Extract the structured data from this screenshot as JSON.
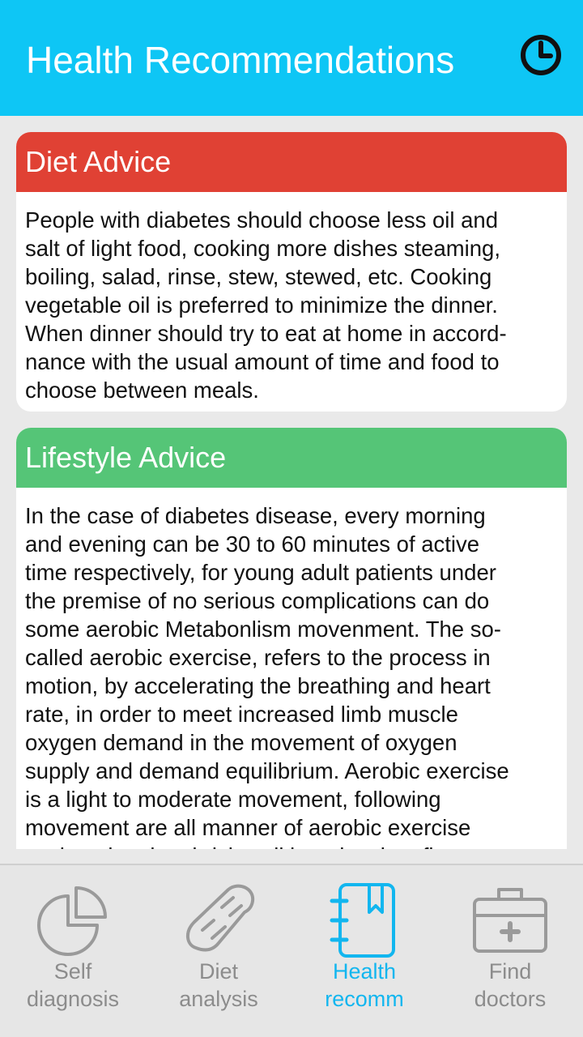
{
  "header": {
    "title": "Health Recommendations",
    "history_icon": "clock-icon"
  },
  "cards": [
    {
      "title": "Diet Advice",
      "color": "#e04134",
      "body": "People with diabetes should choose less oil and\nsalt of light food, cooking more dishes steaming,\nboiling, salad, rinse, stew, stewed, etc. Cooking\nvegetable oil is preferred to minimize the dinner.\nWhen dinner should try to eat at home in accord-\nnance with the usual amount of time and food to\nchoose between meals."
    },
    {
      "title": "Lifestyle Advice",
      "color": "#55c577",
      "body": "In the case of diabetes disease, every morning\nand evening can be 30 to 60 minutes of active\ntime respectively, for young adult patients under\nthe premise of no serious complications can do\nsome aerobic Metabonlism movenment. The so-\ncalled aerobic exercise, refers to the process in\nmotion, by accelerating the breathing and heart\nrate, in order to meet increased limb muscle\noxygen demand in the movement of oxygen\nsupply and demand equilibrium. Aerobic exercise\nis a light to moderate movement, following\nmovement are all manner of aerobic exercise\nsuch as jogging, brisk walking, dancing, fitness"
    }
  ],
  "tabs": [
    {
      "label": "Self\ndiagnosis",
      "icon": "pie-chart-icon",
      "active": false
    },
    {
      "label": "Diet\nanalysis",
      "icon": "bread-icon",
      "active": false
    },
    {
      "label": "Health\nrecomm",
      "icon": "notebook-icon",
      "active": true
    },
    {
      "label": "Find\ndoctors",
      "icon": "medical-kit-icon",
      "active": false
    }
  ],
  "colors": {
    "app_bar": "#0ec6f5",
    "tab_active": "#12b6ef",
    "tab_inactive": "#8c8c8c",
    "background": "#e9e9e9"
  }
}
